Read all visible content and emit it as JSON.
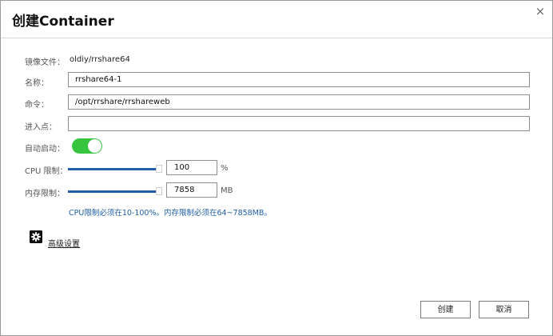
{
  "dialog": {
    "title": "创建Container",
    "close_glyph": "×"
  },
  "form": {
    "image_label": "镜像文件：",
    "image_value": "oldiy/rrshare64",
    "name_label": "名称：",
    "name_value": "rrshare64-1",
    "command_label": "命令：",
    "command_value": "/opt/rrshare/rrshareweb",
    "entrypoint_label": "进入点：",
    "entrypoint_value": "",
    "autostart_label": "自动启动：",
    "autostart_on": true,
    "cpu_label": "CPU 限制：",
    "cpu_value": "100",
    "cpu_unit": "%",
    "cpu_slider_level": 1.0,
    "mem_label": "内存限制：",
    "mem_value": "7858",
    "mem_unit": "MB",
    "mem_slider_level": 1.0,
    "hint": "CPU限制必须在10-100%。内存限制必须在64~7858MB。"
  },
  "advanced": {
    "icon": "gear-icon",
    "label": "高级设置"
  },
  "buttons": {
    "create": "创建",
    "cancel": "取消"
  },
  "colors": {
    "accent": "#1f5fa8",
    "toggle_on": "#37c53f"
  }
}
